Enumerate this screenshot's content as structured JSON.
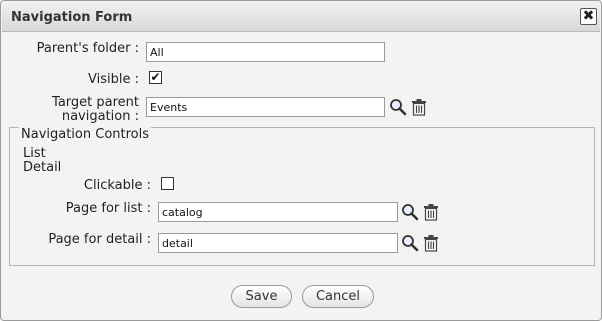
{
  "dialog": {
    "title": "Navigation Form",
    "close_glyph": "✖"
  },
  "fields": {
    "parents_folder": {
      "label": "Parent's folder :",
      "value": "All"
    },
    "visible": {
      "label": "Visible :",
      "checked": true,
      "mark": "✔"
    },
    "target_parent": {
      "label_line1": "Target parent",
      "label_line2": "navigation :",
      "value": "Events"
    }
  },
  "nav_controls": {
    "legend": "Navigation Controls",
    "items": [
      "List",
      "Detail"
    ],
    "clickable": {
      "label": "Clickable :",
      "checked": false
    },
    "page_for_list": {
      "label": "Page for list :",
      "value": "catalog"
    },
    "page_for_detail": {
      "label": "Page for detail :",
      "value": "detail"
    }
  },
  "buttons": {
    "save": "Save",
    "cancel": "Cancel"
  },
  "icons": {
    "search": "search-icon",
    "delete": "trash-icon"
  }
}
